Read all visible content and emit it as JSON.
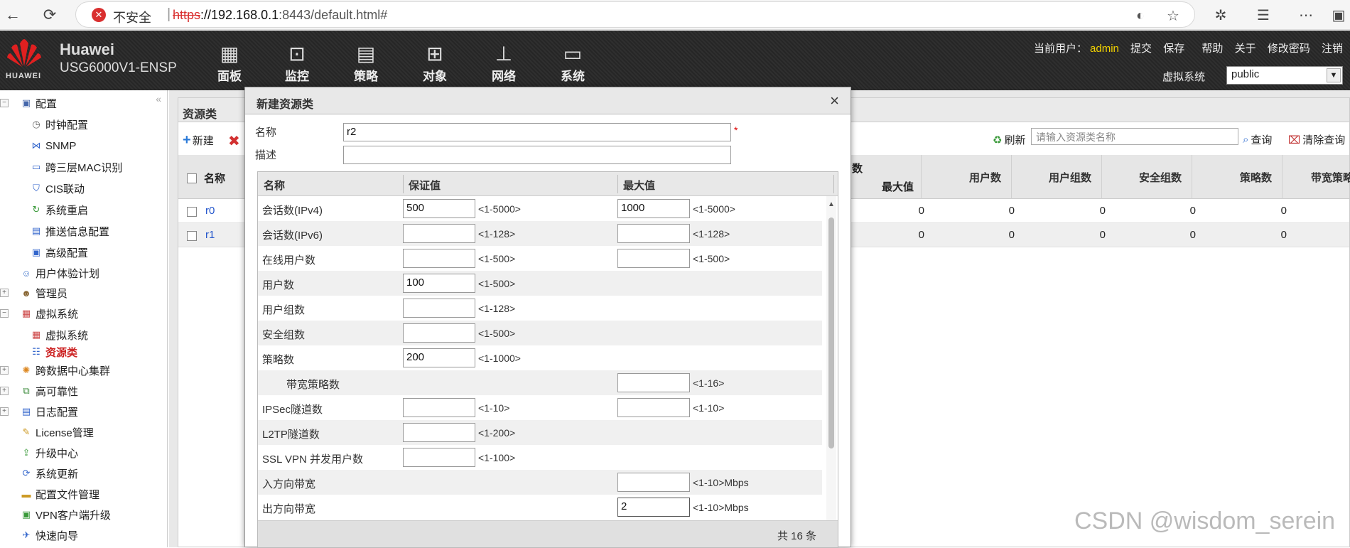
{
  "browser": {
    "insecure_label": "不安全",
    "url_scheme": "https",
    "url_host": "://192.168.0.1",
    "url_rest": ":8443/default.html#"
  },
  "header": {
    "brand": "Huawei",
    "model": "USG6000V1-ENSP",
    "logo_text": "HUAWEI",
    "menu": [
      {
        "label": "面板",
        "icon": "dashboard-icon"
      },
      {
        "label": "监控",
        "icon": "monitor-icon"
      },
      {
        "label": "策略",
        "icon": "policy-icon"
      },
      {
        "label": "对象",
        "icon": "object-icon"
      },
      {
        "label": "网络",
        "icon": "network-icon"
      },
      {
        "label": "系统",
        "icon": "system-icon"
      }
    ],
    "current_user_label": "当前用户：",
    "current_user": "admin",
    "links": [
      "提交",
      "保存",
      "帮助",
      "关于",
      "修改密码",
      "注销"
    ],
    "vsys_label": "虚拟系统",
    "vsys_value": "public"
  },
  "sidebar": {
    "items": [
      {
        "label": "配置",
        "toggle": "−"
      },
      {
        "label": "时钟配置"
      },
      {
        "label": "SNMP"
      },
      {
        "label": "跨三层MAC识别"
      },
      {
        "label": "CIS联动"
      },
      {
        "label": "系统重启"
      },
      {
        "label": "推送信息配置"
      },
      {
        "label": "高级配置"
      },
      {
        "label": "用户体验计划"
      },
      {
        "label": "管理员",
        "toggle": "+"
      },
      {
        "label": "虚拟系统",
        "toggle": "−"
      },
      {
        "label": "虚拟系统"
      },
      {
        "label": "资源类"
      },
      {
        "label": "跨数据中心集群",
        "toggle": "+"
      },
      {
        "label": "高可靠性",
        "toggle": "+"
      },
      {
        "label": "日志配置",
        "toggle": "+"
      },
      {
        "label": "License管理"
      },
      {
        "label": "升级中心"
      },
      {
        "label": "系统更新"
      },
      {
        "label": "配置文件管理"
      },
      {
        "label": "VPN客户端升级"
      },
      {
        "label": "快速向导"
      }
    ]
  },
  "main": {
    "panel_title": "资源类",
    "new_label": "新建",
    "refresh_label": "刷新",
    "search_placeholder": "请输入资源类名称",
    "query_label": "查询",
    "clear_label": "清除查询",
    "columns": {
      "name": "名称",
      "partial": "数",
      "max": "最大值",
      "users": "用户数",
      "user_groups": "用户组数",
      "security_groups": "安全组数",
      "policies": "策略数",
      "bw_policies": "带宽策略"
    },
    "rows": [
      {
        "name": "r0",
        "values": [
          "0",
          "0",
          "0",
          "0",
          "0"
        ]
      },
      {
        "name": "r1",
        "values": [
          "0",
          "0",
          "0",
          "0",
          "0"
        ]
      }
    ]
  },
  "dialog": {
    "title": "新建资源类",
    "close": "×",
    "name_label": "名称",
    "name_value": "r2",
    "required_mark": "*",
    "desc_label": "描述",
    "desc_value": "",
    "table_headers": {
      "name": "名称",
      "guarantee": "保证值",
      "max": "最大值"
    },
    "rows": [
      {
        "label": "会话数(IPv4)",
        "g": "500",
        "g_range": "<1-5000>",
        "m": "1000",
        "m_range": "<1-5000>"
      },
      {
        "label": "会话数(IPv6)",
        "g": "",
        "g_range": "<1-128>",
        "m": "",
        "m_range": "<1-128>"
      },
      {
        "label": "在线用户数",
        "g": "",
        "g_range": "<1-500>",
        "m": "",
        "m_range": "<1-500>"
      },
      {
        "label": "用户数",
        "g": "100",
        "g_range": "<1-500>"
      },
      {
        "label": "用户组数",
        "g": "",
        "g_range": "<1-128>"
      },
      {
        "label": "安全组数",
        "g": "",
        "g_range": "<1-500>"
      },
      {
        "label": "策略数",
        "g": "200",
        "g_range": "<1-1000>"
      },
      {
        "label": "带宽策略数",
        "m": "",
        "m_range": "<1-16>",
        "indent": true
      },
      {
        "label": "IPSec隧道数",
        "g": "",
        "g_range": "<1-10>",
        "m": "",
        "m_range": "<1-10>"
      },
      {
        "label": "L2TP隧道数",
        "g": "",
        "g_range": "<1-200>"
      },
      {
        "label": "SSL VPN 并发用户数",
        "g": "",
        "g_range": "<1-100>"
      },
      {
        "label": "入方向带宽",
        "m": "",
        "m_range": "<1-10>Mbps"
      },
      {
        "label": "出方向带宽",
        "m": "2",
        "m_range": "<1-10>Mbps"
      }
    ],
    "footer": "共 16 条"
  },
  "watermark": "CSDN @wisdom_serein"
}
